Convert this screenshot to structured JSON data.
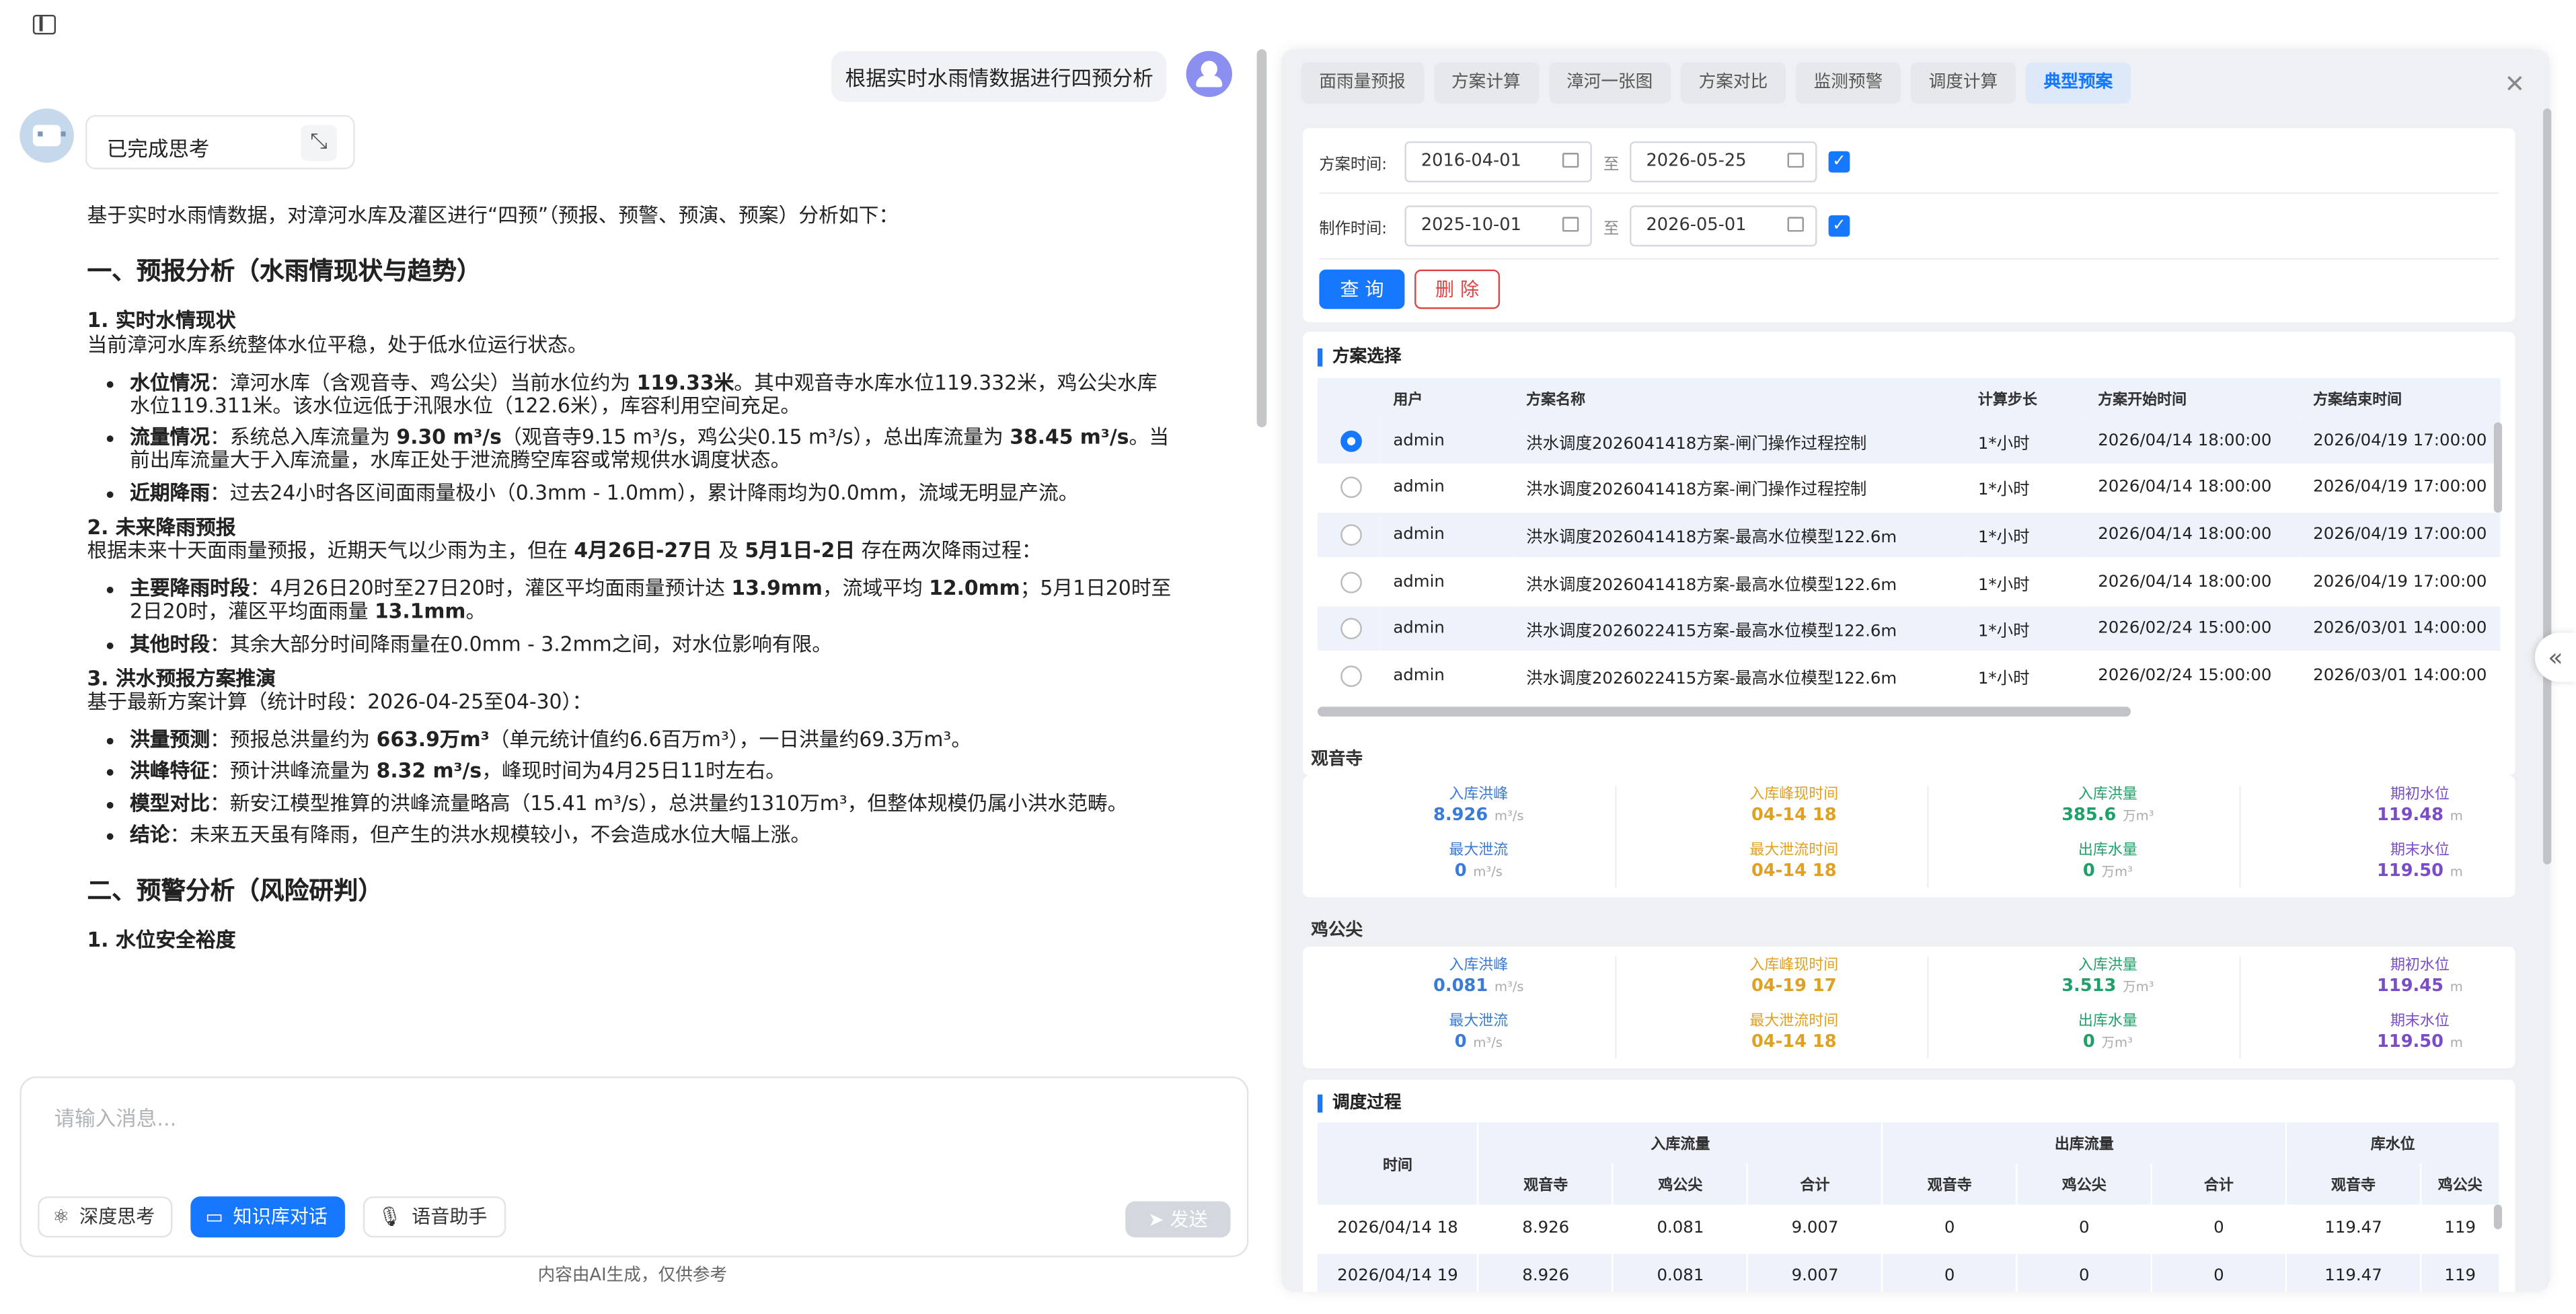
{
  "chat": {
    "user_message": "根据实时水雨情数据进行四预分析",
    "think_label": "已完成思考",
    "intro": "基于实时水雨情数据，对漳河水库及灌区进行“四预”（预报、预警、预演、预案）分析如下：",
    "h1": "一、预报分析（水雨情现状与趋势）",
    "s1_title": "1. 实时水情现状",
    "s1_text": "当前漳河水库系统整体水位平稳，处于低水位运行状态。",
    "s1_b1_k": "水位情况",
    "s1_b1_a": "：漳河水库（含观音寺、鸡公尖）当前水位约为 ",
    "s1_b1_v": "119.33米",
    "s1_b1_b": "。其中观音寺水库水位119.332米，鸡公尖水库水位119.311米。该水位远低于汛限水位（122.6米），库容利用空间充足。",
    "s1_b2_k": "流量情况",
    "s1_b2_a": "：系统总入库流量为 ",
    "s1_b2_v": "9.30 m³/s",
    "s1_b2_b": "（观音寺9.15 m³/s，鸡公尖0.15 m³/s），总出库流量为 ",
    "s1_b2_v2": "38.45 m³/s",
    "s1_b2_c": "。当前出库流量大于入库流量，水库正处于泄流腾空库容或常规供水调度状态。",
    "s1_b3_k": "近期降雨",
    "s1_b3_a": "：过去24小时各区间面雨量极小（0.3mm - 1.0mm），累计降雨均为0.0mm，流域无明显产流。",
    "s2_title": "2. 未来降雨预报",
    "s2_text_a": "根据未来十天面雨量预报，近期天气以少雨为主，但在 ",
    "s2_text_v1": "4月26日-27日",
    "s2_text_m": " 及 ",
    "s2_text_v2": "5月1日-2日",
    "s2_text_b": " 存在两次降雨过程：",
    "s2_b1_k": "主要降雨时段",
    "s2_b1_a": "：4月26日20时至27日20时，灌区平均面雨量预计达 ",
    "s2_b1_v": "13.9mm",
    "s2_b1_m": "，流域平均 ",
    "s2_b1_v2": "12.0mm",
    "s2_b1_b": "；5月1日20时至2日20时，灌区平均面雨量 ",
    "s2_b1_v3": "13.1mm",
    "s2_b1_c": "。",
    "s2_b2_k": "其他时段",
    "s2_b2_a": "：其余大部分时间降雨量在0.0mm - 3.2mm之间，对水位影响有限。",
    "s3_title": "3. 洪水预报方案推演",
    "s3_text": "基于最新方案计算（统计时段：2026-04-25至04-30）：",
    "s3_b1_k": "洪量预测",
    "s3_b1_a": "：预报总洪量约为 ",
    "s3_b1_v": "663.9万m³",
    "s3_b1_b": "（单元统计值约6.6百万m³），一日洪量约69.3万m³。",
    "s3_b2_k": "洪峰特征",
    "s3_b2_a": "：预计洪峰流量为 ",
    "s3_b2_v": "8.32 m³/s",
    "s3_b2_b": "，峰现时间为4月25日11时左右。",
    "s3_b3_k": "模型对比",
    "s3_b3_a": "：新安江模型推算的洪峰流量略高（15.41 m³/s），总洪量约1310万m³，但整体规模仍属小洪水范畴。",
    "s3_b4_k": "结论",
    "s3_b4_a": "：未来五天虽有降雨，但产生的洪水规模较小，不会造成水位大幅上涨。",
    "h2": "二、预警分析（风险研判）",
    "s4_title": "1. 水位安全裕度"
  },
  "input": {
    "placeholder": "请输入消息...",
    "deep_think": "深度思考",
    "kb_chat": "知识库对话",
    "voice": "语音助手",
    "send": "发送",
    "disclaimer": "内容由AI生成，仅供参考"
  },
  "panel": {
    "tabs": [
      "面雨量预报",
      "方案计算",
      "漳河一张图",
      "方案对比",
      "监测预警",
      "调度计算",
      "典型预案"
    ],
    "active_tab": "典型预案",
    "plan_time_label": "方案时间:",
    "plan_start": "2016-04-01",
    "plan_end": "2026-05-25",
    "make_time_label": "制作时间:",
    "make_start": "2025-10-01",
    "make_end": "2026-05-01",
    "to": "至",
    "query": "查 询",
    "delete": "删 除",
    "select_title": "方案选择",
    "cols": [
      "用户",
      "方案名称",
      "计算步长",
      "方案开始时间",
      "方案结束时间"
    ],
    "rows": [
      {
        "user": "admin",
        "name": "洪水调度2026041418方案-闸门操作过程控制",
        "step": "1*小时",
        "start": "2026/04/14 18:00:00",
        "end": "2026/04/19 17:00:00",
        "selected": true
      },
      {
        "user": "admin",
        "name": "洪水调度2026041418方案-闸门操作过程控制",
        "step": "1*小时",
        "start": "2026/04/14 18:00:00",
        "end": "2026/04/19 17:00:00",
        "selected": false
      },
      {
        "user": "admin",
        "name": "洪水调度2026041418方案-最高水位模型122.6m",
        "step": "1*小时",
        "start": "2026/04/14 18:00:00",
        "end": "2026/04/19 17:00:00",
        "selected": false
      },
      {
        "user": "admin",
        "name": "洪水调度2026041418方案-最高水位模型122.6m",
        "step": "1*小时",
        "start": "2026/04/14 18:00:00",
        "end": "2026/04/19 17:00:00",
        "selected": false
      },
      {
        "user": "admin",
        "name": "洪水调度2026022415方案-最高水位模型122.6m",
        "step": "1*小时",
        "start": "2026/02/24 15:00:00",
        "end": "2026/03/01 14:00:00",
        "selected": false
      },
      {
        "user": "admin",
        "name": "洪水调度2026022415方案-最高水位模型122.6m",
        "step": "1*小时",
        "start": "2026/02/24 15:00:00",
        "end": "2026/03/01 14:00:00",
        "selected": false
      }
    ],
    "gys": {
      "title": "观音寺",
      "in_peak_l": "入库洪峰",
      "in_peak_v": "8.926",
      "in_peak_u": "m³/s",
      "in_peak_t_l": "入库峰现时间",
      "in_peak_t_v": "04-14 18",
      "in_vol_l": "入库洪量",
      "in_vol_v": "385.6",
      "in_vol_u": "万m³",
      "init_l": "期初水位",
      "init_v": "119.48",
      "init_u": "m",
      "max_out_l": "最大泄流",
      "max_out_v": "0",
      "max_out_u": "m³/s",
      "max_out_t_l": "最大泄流时间",
      "max_out_t_v": "04-14 18",
      "out_vol_l": "出库水量",
      "out_vol_v": "0",
      "out_vol_u": "万m³",
      "end_l": "期末水位",
      "end_v": "119.50",
      "end_u": "m"
    },
    "jgj": {
      "title": "鸡公尖",
      "in_peak_l": "入库洪峰",
      "in_peak_v": "0.081",
      "in_peak_u": "m³/s",
      "in_peak_t_l": "入库峰现时间",
      "in_peak_t_v": "04-19 17",
      "in_vol_l": "入库洪量",
      "in_vol_v": "3.513",
      "in_vol_u": "万m³",
      "init_l": "期初水位",
      "init_v": "119.45",
      "init_u": "m",
      "max_out_l": "最大泄流",
      "max_out_v": "0",
      "max_out_u": "m³/s",
      "max_out_t_l": "最大泄流时间",
      "max_out_t_v": "04-14 18",
      "out_vol_l": "出库水量",
      "out_vol_v": "0",
      "out_vol_u": "万m³",
      "end_l": "期末水位",
      "end_v": "119.50",
      "end_u": "m"
    },
    "proc_title": "调度过程",
    "proc_head": {
      "time": "时间",
      "in": "入库流量",
      "out": "出库流量",
      "lv": "库水位",
      "gys": "观音寺",
      "jgj": "鸡公尖",
      "sum": "合计",
      "jgj_cut": "鸡公尖"
    },
    "proc_rows": [
      [
        "2026/04/14 18",
        "8.926",
        "0.081",
        "9.007",
        "0",
        "0",
        "0",
        "119.47",
        "119"
      ],
      [
        "2026/04/14 19",
        "8.926",
        "0.081",
        "9.007",
        "0",
        "0",
        "0",
        "119.47",
        "119"
      ]
    ]
  }
}
